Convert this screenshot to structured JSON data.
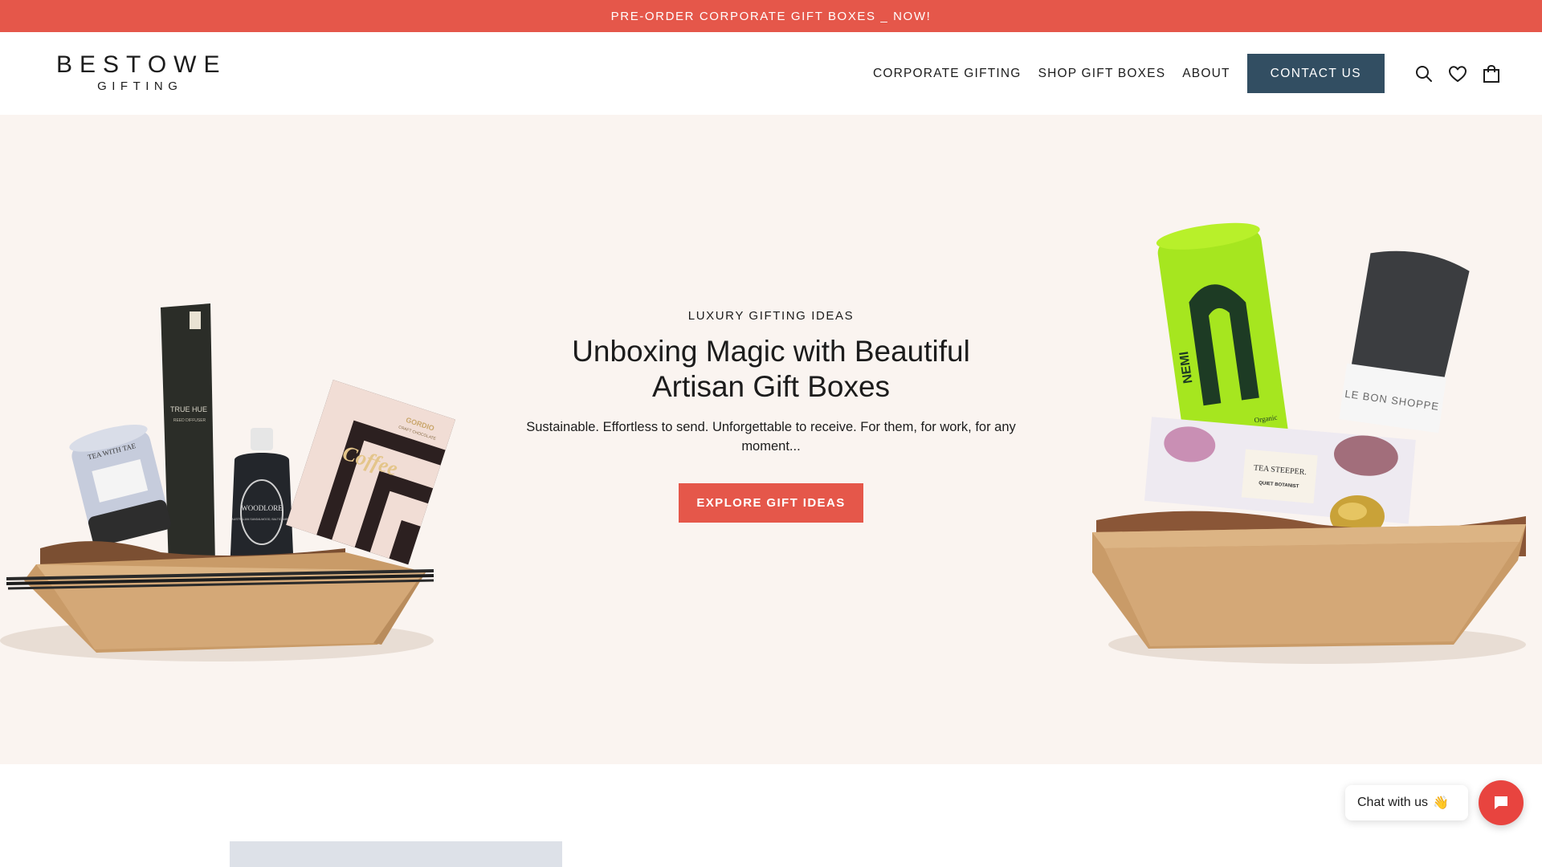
{
  "announcement": {
    "text": "PRE-ORDER CORPORATE GIFT BOXES _ NOW!"
  },
  "header": {
    "logo": {
      "line1": "BESTOWE",
      "line2": "GIFTING"
    },
    "nav": [
      {
        "label": "CORPORATE GIFTING"
      },
      {
        "label": "SHOP GIFT BOXES"
      },
      {
        "label": "ABOUT"
      }
    ],
    "contact_label": "CONTACT US",
    "icons": [
      "search-icon",
      "heart-icon",
      "bag-icon"
    ]
  },
  "hero": {
    "eyebrow": "LUXURY GIFTING IDEAS",
    "title": "Unboxing Magic with Beautiful Artisan Gift Boxes",
    "subtitle": "Sustainable. Effortless to send. Unforgettable to receive. For them, for work, for any moment...",
    "cta_label": "EXPLORE GIFT IDEAS",
    "left_box_labels": {
      "jar": "TEA WITH TAE",
      "diffuser": "TRUE HUE",
      "diffuser_sub": "REED DIFFUSER",
      "bottle": "WOODLORE",
      "bottle_sub": "AUSTRALIAN SANDALWOOD, BALTIC AMBER",
      "box_brand": "GORDIO",
      "box_sub": "CRAFT CHOCOLATE",
      "box_word": "Coffee"
    },
    "right_box_labels": {
      "tin": "NEMI",
      "tin_sub": "Organic",
      "sock_tag": "LE BON SHOPPE",
      "card_title": "TEA STEEPER.",
      "card_sub": "QUIET BOTANIST"
    }
  },
  "chat": {
    "label": "Chat with us",
    "emoji": "👋"
  },
  "colors": {
    "accent": "#e5574a",
    "navy": "#324e62",
    "hero_bg": "#faf4f0",
    "cardboard": "#d4a877"
  }
}
